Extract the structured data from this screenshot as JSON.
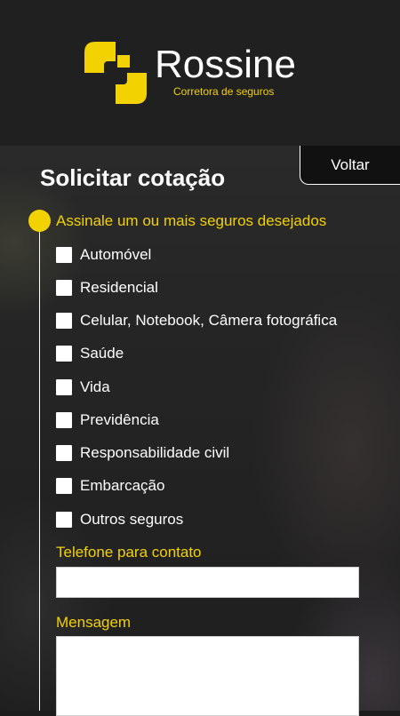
{
  "header": {
    "brand_name": "Rossine",
    "brand_tagline": "Corretora de seguros",
    "accent_color": "#f2d200"
  },
  "nav": {
    "back_label": "Voltar"
  },
  "form": {
    "title": "Solicitar cotação",
    "insurance_prompt": "Assinale um ou mais seguros desejados",
    "options": [
      {
        "label": "Automóvel",
        "checked": false
      },
      {
        "label": "Residencial",
        "checked": false
      },
      {
        "label": "Celular, Notebook, Câmera fotográfica",
        "checked": false
      },
      {
        "label": "Saúde",
        "checked": false
      },
      {
        "label": "Vida",
        "checked": false
      },
      {
        "label": "Previdência",
        "checked": false
      },
      {
        "label": "Responsabilidade civil",
        "checked": false
      },
      {
        "label": "Embarcação",
        "checked": false
      },
      {
        "label": "Outros seguros",
        "checked": false
      }
    ],
    "phone_label": "Telefone para contato",
    "phone_value": "",
    "message_label": "Mensagem",
    "message_value": ""
  }
}
